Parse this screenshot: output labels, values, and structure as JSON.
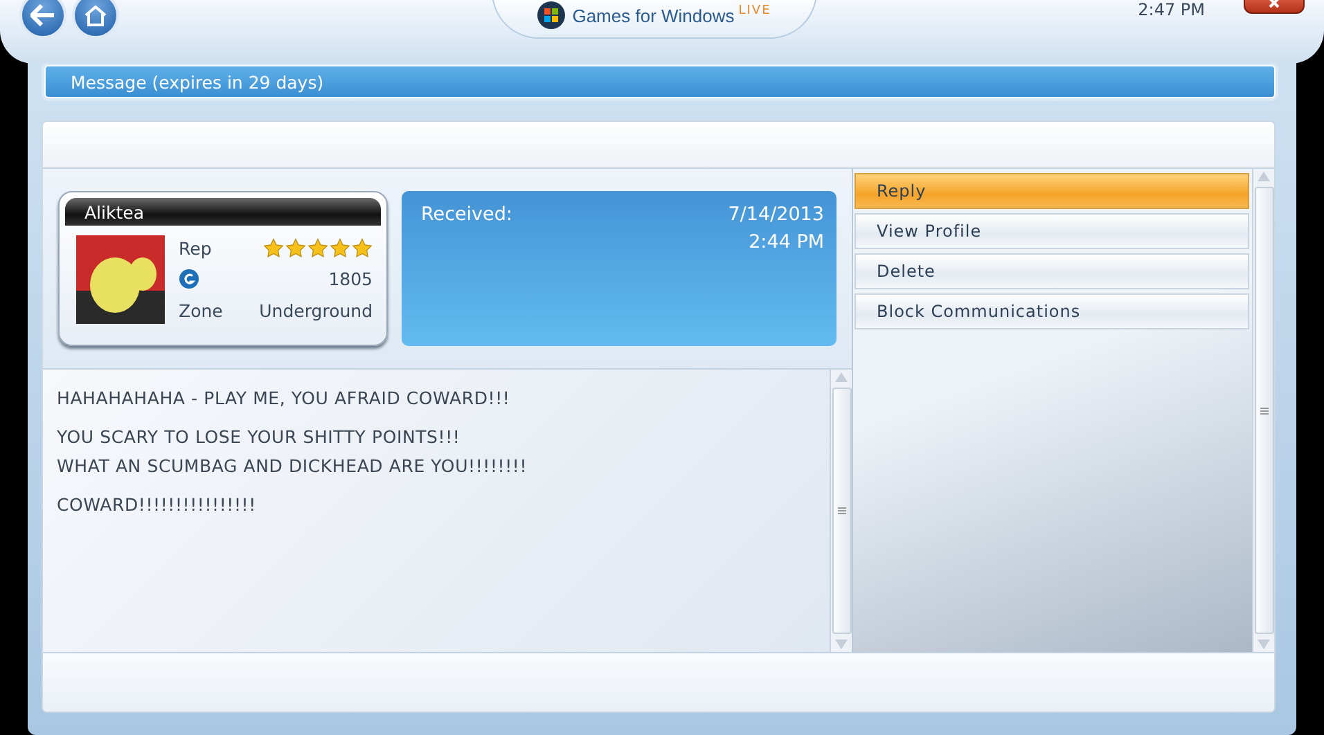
{
  "top_bar": {
    "logo_text": "Games for Windows",
    "logo_badge": "LIVE",
    "clock": "2:47 PM"
  },
  "message_header": {
    "title": "Message (expires in 29 days)"
  },
  "sender": {
    "gamertag": "Aliktea",
    "rep_label": "Rep",
    "stars": 5,
    "gamerscore": "1805",
    "zone_label": "Zone",
    "zone": "Underground"
  },
  "received": {
    "label": "Received:",
    "date": "7/14/2013",
    "time": "2:44 PM"
  },
  "message": {
    "paragraphs": [
      {
        "lines": [
          "HAHAHAHAHA - PLAY ME, YOU AFRAID COWARD!!!"
        ]
      },
      {
        "lines": [
          "YOU SCARY TO LOSE YOUR SHITTY POINTS!!!",
          "WHAT AN SCUMBAG AND DICKHEAD ARE YOU!!!!!!!!"
        ]
      },
      {
        "lines": [
          "COWARD!!!!!!!!!!!!!!!!"
        ]
      }
    ]
  },
  "actions": [
    {
      "label": "Reply",
      "selected": true
    },
    {
      "label": "View Profile",
      "selected": false
    },
    {
      "label": "Delete",
      "selected": false
    },
    {
      "label": "Block Communications",
      "selected": false
    }
  ]
}
